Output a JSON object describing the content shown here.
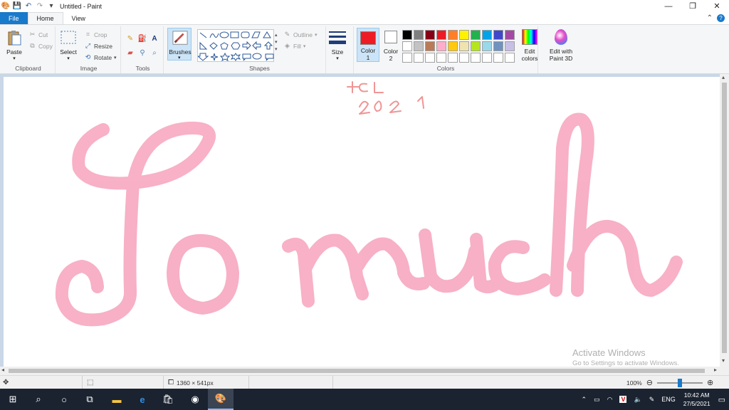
{
  "window": {
    "title": "Untitled - Paint",
    "controls": [
      "—",
      "❐",
      "✕"
    ]
  },
  "tabs": {
    "file": "File",
    "home": "Home",
    "view": "View"
  },
  "clipboard": {
    "label": "Clipboard",
    "paste": "Paste",
    "cut": "Cut",
    "copy": "Copy"
  },
  "image": {
    "label": "Image",
    "select": "Select",
    "crop": "Crop",
    "resize": "Resize",
    "rotate": "Rotate"
  },
  "tools": {
    "label": "Tools"
  },
  "brushes": {
    "label": "Brushes"
  },
  "shapes": {
    "label": "Shapes",
    "outline": "Outline",
    "fill": "Fill"
  },
  "size": {
    "label": "Size"
  },
  "colors": {
    "label": "Colors",
    "color1_line1": "Color",
    "color1_line2": "1",
    "color2_line1": "Color",
    "color2_line2": "2",
    "color1": "#ed1c24",
    "color2": "#ffffff",
    "edit_line1": "Edit",
    "edit_line2": "colors",
    "edit3d_line1": "Edit with",
    "edit3d_line2": "Paint 3D",
    "palette": [
      "#000000",
      "#7f7f7f",
      "#880015",
      "#ed1c24",
      "#ff7f27",
      "#fff200",
      "#22b14c",
      "#00a2e8",
      "#3f48cc",
      "#a349a4",
      "#ffffff",
      "#c3c3c3",
      "#b97a57",
      "#ffaec9",
      "#ffc90e",
      "#efe4b0",
      "#b5e61d",
      "#99d9ea",
      "#7092be",
      "#c8bfe7",
      "#ffffff",
      "#ffffff",
      "#ffffff",
      "#ffffff",
      "#ffffff",
      "#ffffff",
      "#ffffff",
      "#ffffff",
      "#ffffff",
      "#ffffff"
    ]
  },
  "canvas": {
    "text_small_1": "HCL",
    "text_small_2": "2021",
    "text_big": "So much",
    "ink_color": "#f7a8c0"
  },
  "status": {
    "dimensions": "1360 × 541px",
    "zoom": "100%"
  },
  "watermark": {
    "line1": "Activate Windows",
    "line2": "Go to Settings to activate Windows."
  },
  "taskbar": {
    "language": "ENG",
    "time": "10:42 AM",
    "date": "27/5/2021"
  }
}
